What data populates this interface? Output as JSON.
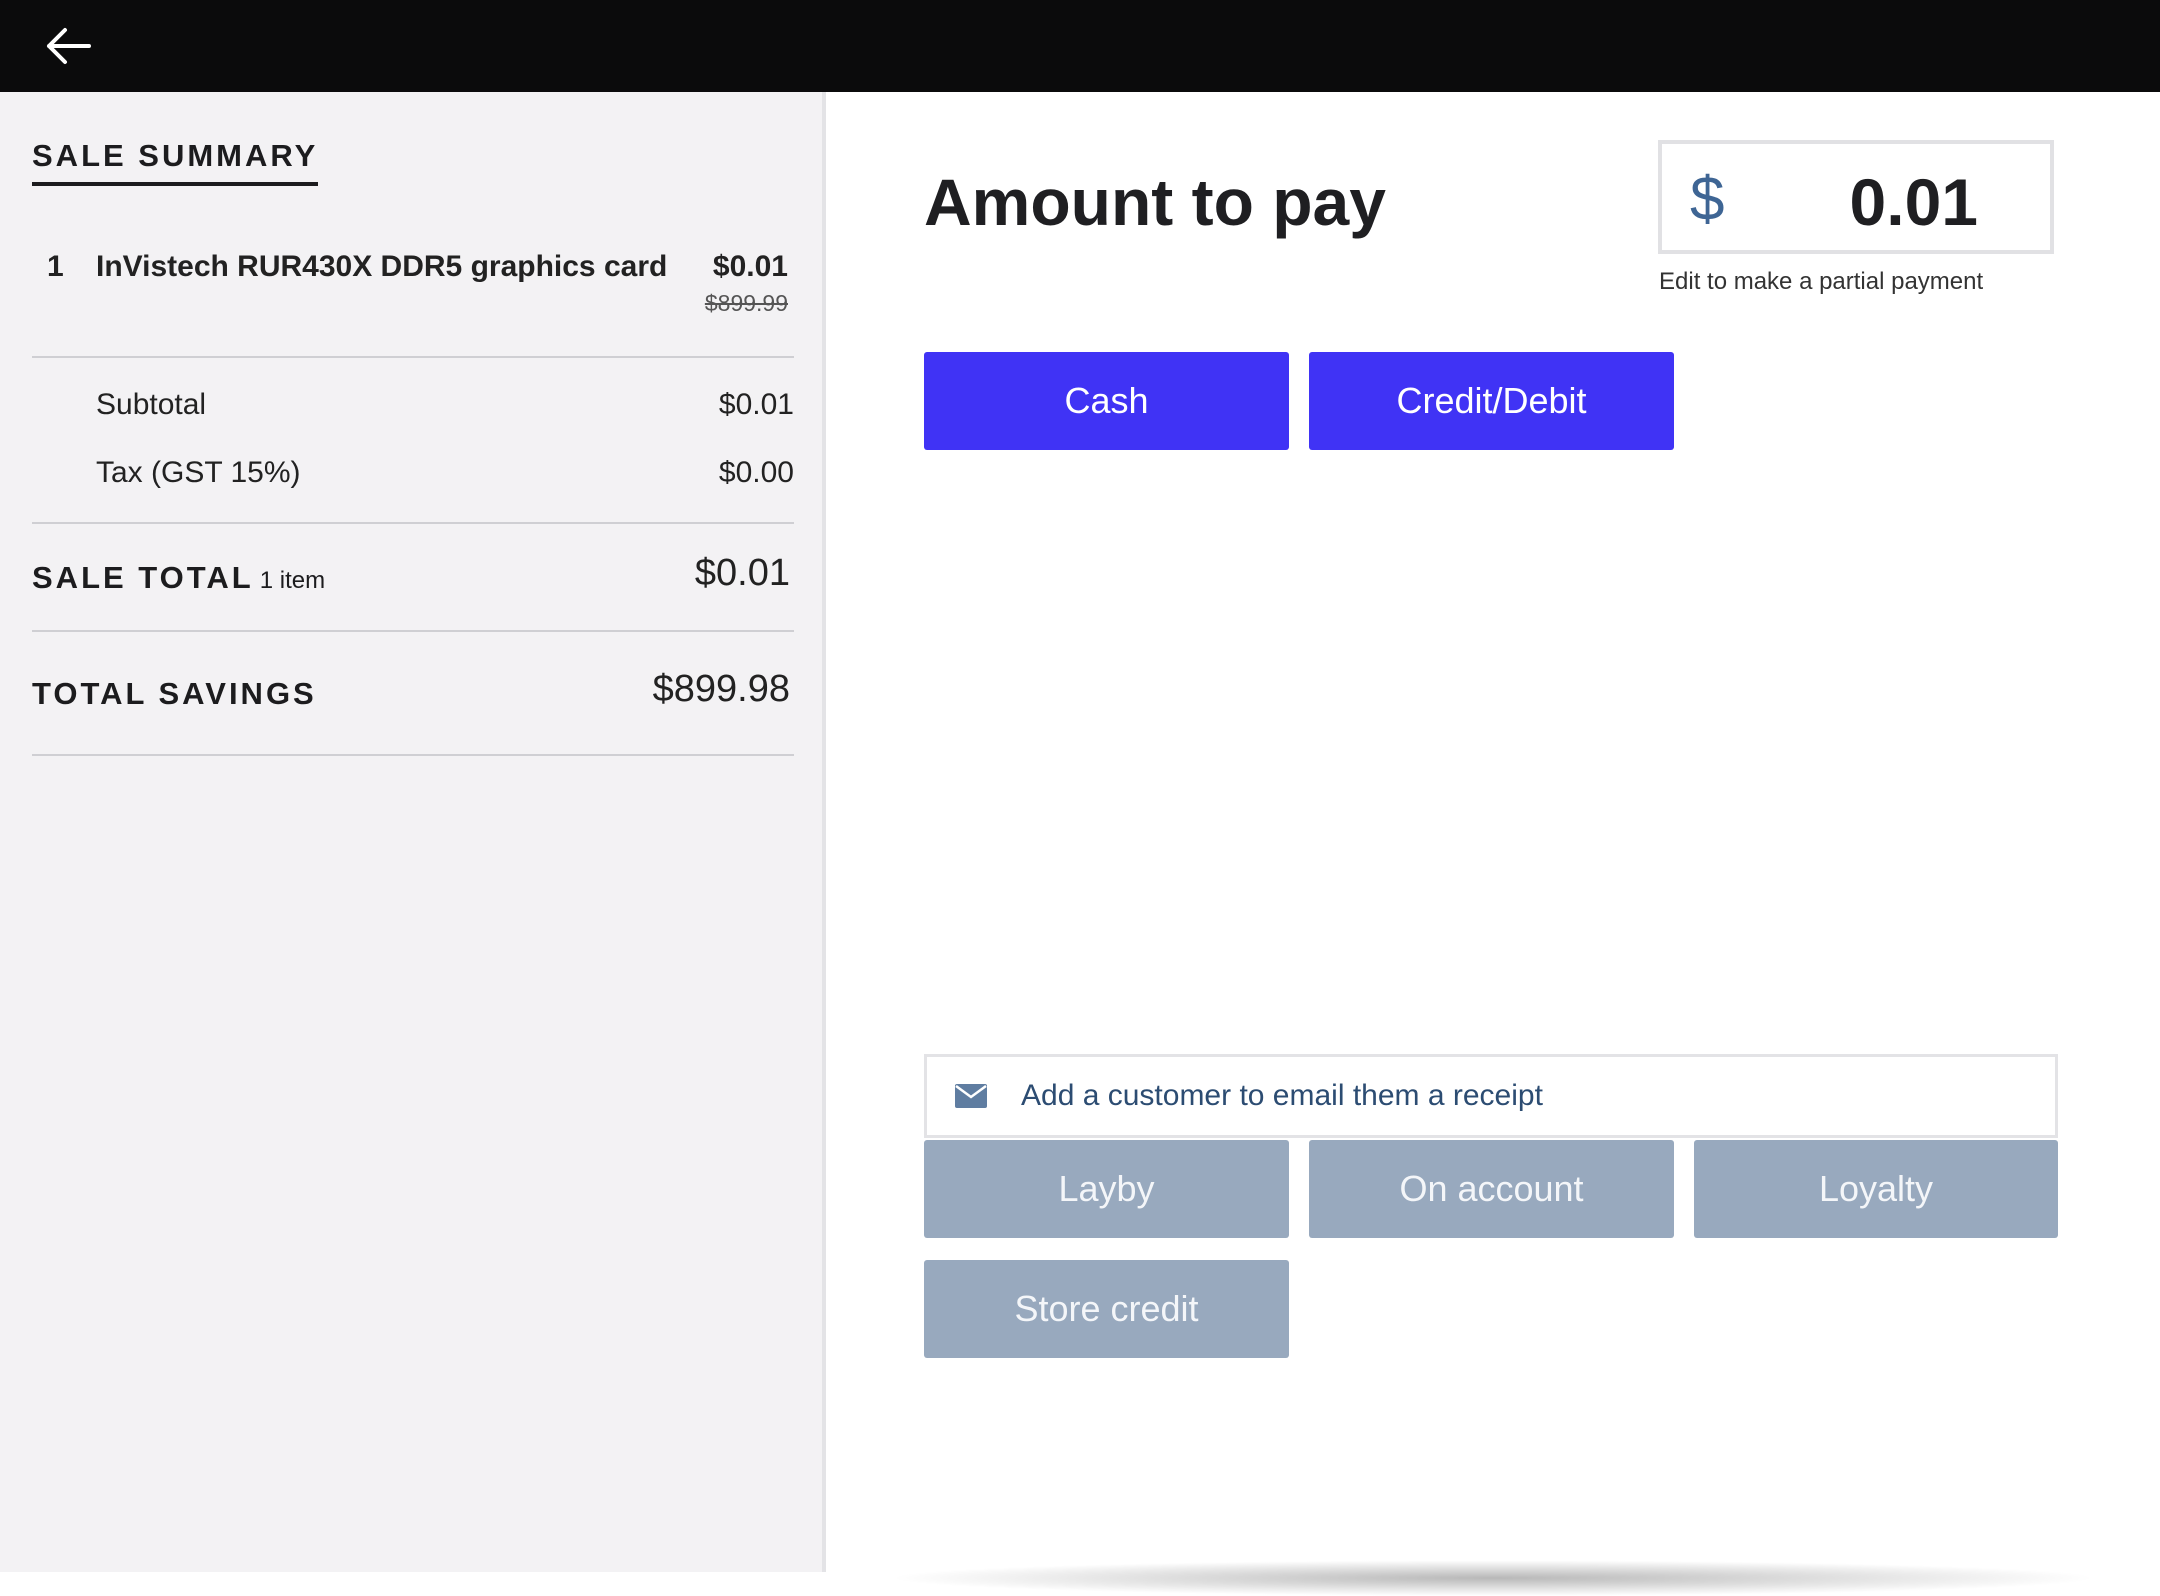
{
  "topbar": {
    "back_icon": "arrow-left-icon"
  },
  "summary": {
    "title": "SALE SUMMARY",
    "items": [
      {
        "qty": "1",
        "name": "InVistech RUR430X DDR5 graphics card",
        "price": "$0.01",
        "original_price": "$899.99"
      }
    ],
    "subtotal": {
      "label": "Subtotal",
      "value": "$0.01"
    },
    "tax": {
      "label": "Tax (GST 15%)",
      "value": "$0.00"
    },
    "sale_total": {
      "label": "SALE TOTAL",
      "sub": "1 item",
      "value": "$0.01"
    },
    "total_savings": {
      "label": "TOTAL SAVINGS",
      "value": "$899.98"
    }
  },
  "payment": {
    "title": "Amount to pay",
    "currency_symbol": "$",
    "amount": "0.01",
    "hint": "Edit to make a partial payment",
    "methods": [
      {
        "label": "Cash",
        "enabled": true
      },
      {
        "label": "Credit/Debit",
        "enabled": true
      }
    ],
    "email_receipt": {
      "icon": "envelope-icon",
      "text": "Add a customer to email them a receipt"
    },
    "other_methods": [
      {
        "label": "Layby",
        "enabled": false
      },
      {
        "label": "On account",
        "enabled": false
      },
      {
        "label": "Loyalty",
        "enabled": false
      },
      {
        "label": "Store credit",
        "enabled": false
      }
    ],
    "colors": {
      "primary": "#4033f5",
      "disabled": "#98a9be",
      "accent_text": "#2c4c72"
    }
  }
}
